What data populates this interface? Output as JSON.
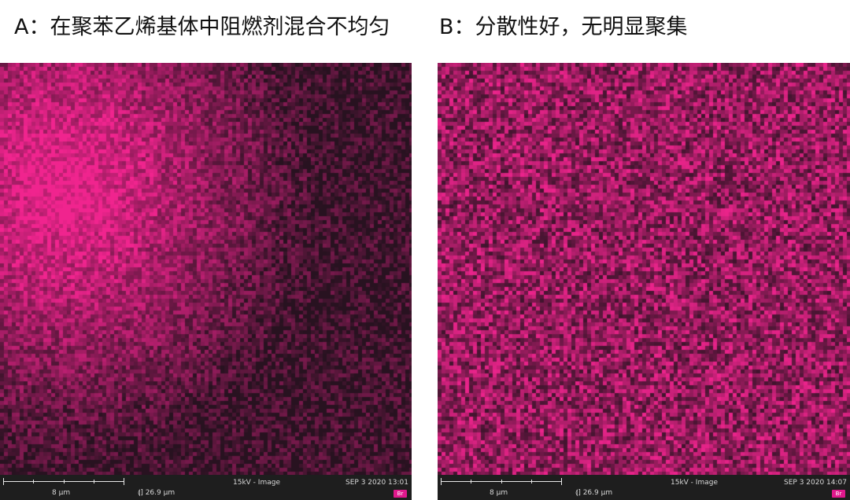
{
  "captions": {
    "a": "A：在聚苯乙烯基体中阻燃剂混合不均匀",
    "b": "B：分散性好，无明显聚集"
  },
  "panels": {
    "a": {
      "scale_label": "8 μm",
      "hfw": "⟬] 26.9 μm",
      "voltage": "15kV - Image",
      "date": "SEP 3 2020 13:01",
      "element": "Br"
    },
    "b": {
      "scale_label": "8 μm",
      "hfw": "⟬] 26.9 μm",
      "voltage": "15kV - Image",
      "date": "SEP 3 2020 14:07",
      "element": "Br"
    }
  },
  "colors": {
    "map_bright": "#e8218f",
    "map_dark": "#2a1420",
    "badge": "#e0188c"
  }
}
